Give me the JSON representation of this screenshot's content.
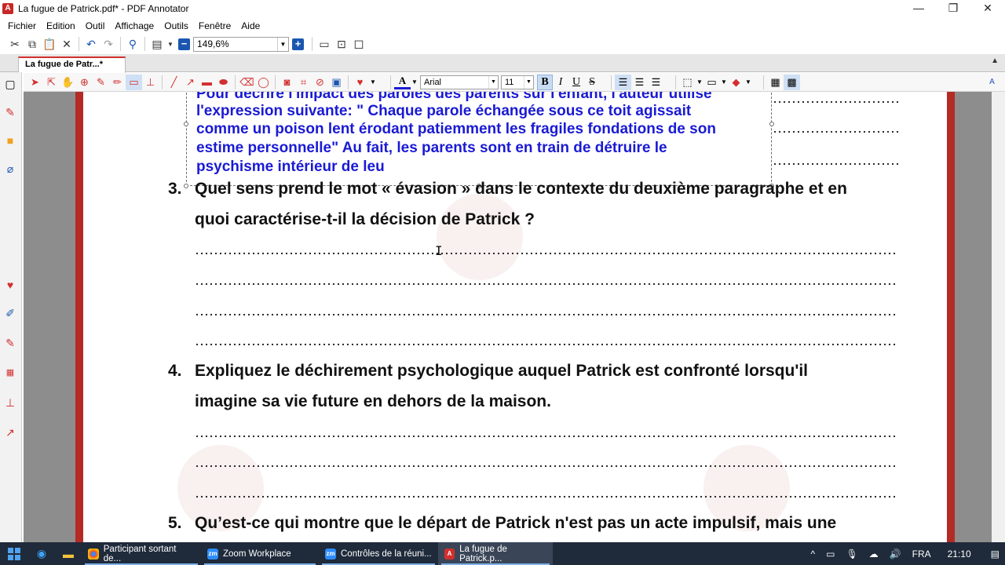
{
  "window": {
    "title": "La fugue de Patrick.pdf* - PDF Annotator",
    "app_icon_letter": "A"
  },
  "window_controls": {
    "minimize": "—",
    "restore": "❐",
    "close": "✕"
  },
  "menu": [
    "Fichier",
    "Edition",
    "Outil",
    "Affichage",
    "Outils",
    "Fenêtre",
    "Aide"
  ],
  "toolbar": {
    "zoom_value": "149,6%",
    "zoom_out": "−",
    "zoom_in": "+"
  },
  "tabs": [
    {
      "label": "La fugue de Patr...*"
    }
  ],
  "annotation_toolbar": {
    "font_name": "Arial",
    "font_size": "11",
    "bold": "B",
    "italic": "I",
    "underline": "U",
    "strike": "S",
    "text_color_glyph": "A"
  },
  "document": {
    "annotation_lines": [
      "Pour décrire l'impact des paroles des parents sur l'enfant, l'auteur utilise",
      "l'expression suivante: \" Chaque parole échangée sous ce toit agissait",
      "comme un poison lent érodant patiemment les fragiles fondations de son",
      "estime personnelle\" Au fait, les parents sont en train de détruire le",
      "psychisme intérieur de leu"
    ],
    "questions": [
      {
        "number": "3.",
        "lines": [
          "Quel sens prend le mot « évasion » dans le contexte du deuxième paragraphe et en",
          "quoi caractérise-t-il la décision de Patrick ?"
        ]
      },
      {
        "number": "4.",
        "lines": [
          "Expliquez le déchirement psychologique auquel Patrick est confronté lorsqu'il",
          "imagine sa vie future en dehors de la maison."
        ]
      },
      {
        "number": "5.",
        "lines": [
          "Qu’est-ce qui montre que le départ de Patrick n'est pas un acte impulsif, mais une"
        ]
      }
    ]
  },
  "taskbar": {
    "apps": [
      {
        "label": "Participant sortant de...",
        "icon": "chrome-icon"
      },
      {
        "label": "Zoom Workplace",
        "icon": "zm"
      },
      {
        "label": "Contrôles de la réuni...",
        "icon": "zm"
      },
      {
        "label": "La fugue de Patrick.p...",
        "icon": "pdf-annotator-icon"
      }
    ],
    "tray": {
      "chevron": "^",
      "language": "FRA",
      "time": "21:10"
    }
  },
  "colors": {
    "accent_red": "#d32f2f",
    "annotation_blue": "#1a1ad4",
    "taskbar_bg": "#1f2a3a"
  }
}
